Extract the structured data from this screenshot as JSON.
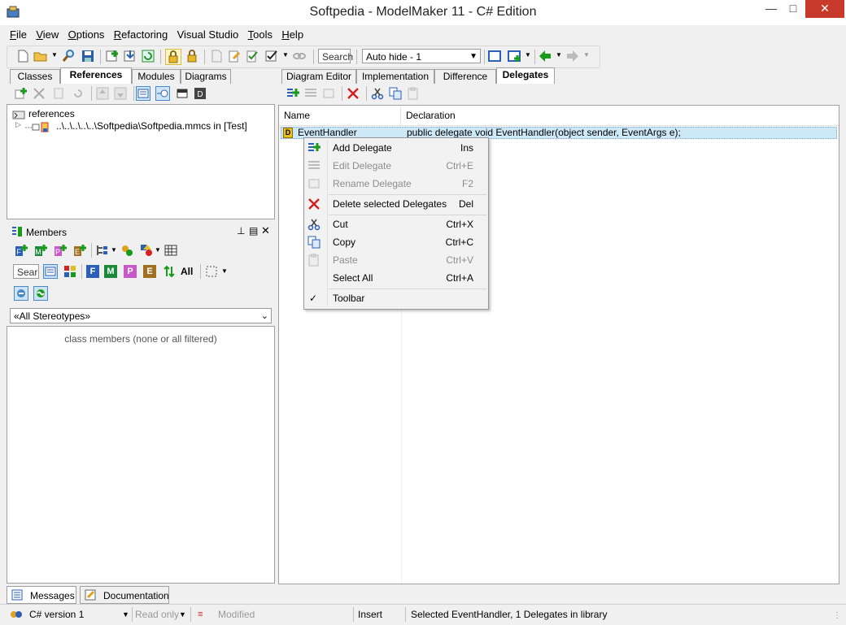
{
  "window": {
    "title": "Softpedia - ModelMaker 11 - C# Edition"
  },
  "menu": [
    {
      "pre": "",
      "ul": "F",
      "post": "ile"
    },
    {
      "pre": "",
      "ul": "V",
      "post": "iew"
    },
    {
      "pre": "",
      "ul": "O",
      "post": "ptions"
    },
    {
      "pre": "",
      "ul": "R",
      "post": "efactoring"
    },
    {
      "pre": "Visual Studio",
      "ul": "",
      "post": ""
    },
    {
      "pre": "",
      "ul": "T",
      "post": "ools"
    },
    {
      "pre": "",
      "ul": "H",
      "post": "elp"
    }
  ],
  "toolbar": {
    "search_placeholder": "Search",
    "layout_combo": "Auto hide - 1"
  },
  "left_tabs": [
    "Classes",
    "References",
    "Modules",
    "Diagrams"
  ],
  "right_tabs": [
    "Diagram Editor",
    "Implementation",
    "Difference",
    "Delegates"
  ],
  "references": {
    "root": "references",
    "child": "..\\..\\..\\..\\..\\Softpedia\\Softpedia.mmcs in [Test]"
  },
  "members": {
    "title": "Members",
    "search_placeholder": "Searc",
    "filter_letters": [
      "F",
      "M",
      "P",
      "E"
    ],
    "all_label": "All",
    "stereotype_combo": "«All Stereotypes»",
    "empty_text": "class members (none or all filtered)"
  },
  "delegates": {
    "col_name": "Name",
    "col_declaration": "Declaration",
    "row": {
      "badge": "D",
      "name": "EventHandler",
      "declaration": "public delegate void EventHandler(object sender, EventArgs e);"
    }
  },
  "context_menu": [
    {
      "label": "Add Delegate",
      "shortcut": "Ins",
      "disabled": false
    },
    {
      "label": "Edit Delegate",
      "shortcut": "Ctrl+E",
      "disabled": true
    },
    {
      "label": "Rename Delegate",
      "shortcut": "F2",
      "disabled": true
    },
    {
      "label": "Delete selected Delegates",
      "shortcut": "Del",
      "disabled": false
    },
    {
      "label": "Cut",
      "shortcut": "Ctrl+X",
      "disabled": false
    },
    {
      "label": "Copy",
      "shortcut": "Ctrl+C",
      "disabled": false
    },
    {
      "label": "Paste",
      "shortcut": "Ctrl+V",
      "disabled": true
    },
    {
      "label": "Select All",
      "shortcut": "Ctrl+A",
      "disabled": false
    },
    {
      "label": "Toolbar",
      "shortcut": "",
      "checked": true
    }
  ],
  "bottom_tabs": [
    "Messages",
    "Documentation"
  ],
  "status": {
    "language": "C# version 1",
    "readonly": "Read only",
    "modified": "Modified",
    "mode": "Insert",
    "message": "Selected EventHandler, 1 Delegates in library"
  },
  "colors": {
    "accent_blue": "#1e5fb4",
    "selection": "#cde8f7",
    "delete_red": "#d42020"
  }
}
